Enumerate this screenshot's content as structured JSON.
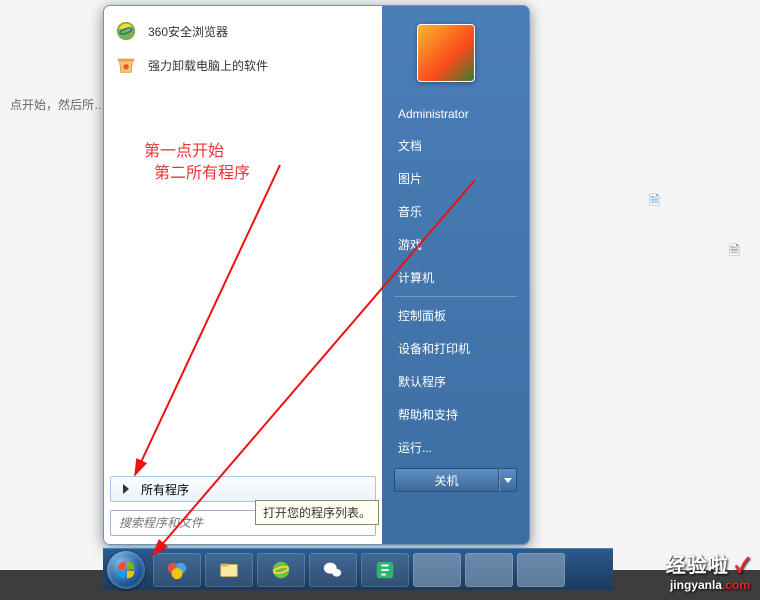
{
  "background": {
    "instruction_text": "点开始，然后所…"
  },
  "annotation": {
    "line1": "第一点开始",
    "line2": "第二所有程序"
  },
  "start_menu": {
    "pinned": [
      {
        "label": "360安全浏览器",
        "icon": "ie-360"
      },
      {
        "label": "强力卸载电脑上的软件",
        "icon": "trash"
      }
    ],
    "all_programs_label": "所有程序",
    "search_placeholder": "搜索程序和文件",
    "tooltip": "打开您的程序列表。",
    "user_name": "Administrator",
    "right_items": [
      "文档",
      "图片",
      "音乐",
      "游戏",
      "计算机"
    ],
    "right_items2": [
      "控制面板",
      "设备和打印机",
      "默认程序",
      "帮助和支持",
      "运行..."
    ],
    "shutdown_label": "关机"
  },
  "watermark": {
    "brand": "经验啦",
    "mark": "✓",
    "domain_prefix": "jingyanla",
    "domain_suffix": ".com"
  }
}
